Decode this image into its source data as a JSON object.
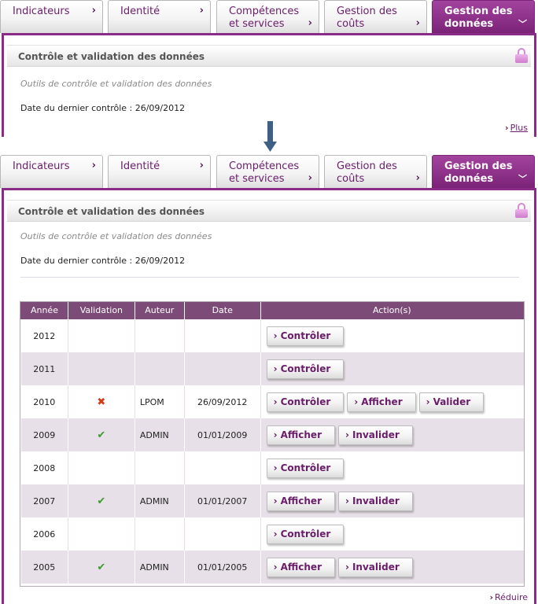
{
  "tabs": [
    {
      "label_line1": "Indicateurs",
      "label_line2": ""
    },
    {
      "label_line1": "Identité",
      "label_line2": ""
    },
    {
      "label_line1": "Compétences",
      "label_line2": "et services"
    },
    {
      "label_line1": "Gestion des",
      "label_line2": "coûts"
    },
    {
      "label_line1": "Gestion des",
      "label_line2": "données"
    }
  ],
  "panel": {
    "title": "Contrôle et validation des données",
    "subtitle": "Outils de contrôle et validation des données",
    "last_check": "Date du dernier contrôle : 26/09/2012",
    "more_link": "Plus",
    "less_link": "Réduire"
  },
  "table": {
    "headers": [
      "Année",
      "Validation",
      "Auteur",
      "Date",
      "Action(s)"
    ],
    "rows": [
      {
        "year": "2012",
        "validation": "",
        "author": "",
        "date": "",
        "actions": [
          "Contrôler"
        ]
      },
      {
        "year": "2011",
        "validation": "",
        "author": "",
        "date": "",
        "actions": [
          "Contrôler"
        ]
      },
      {
        "year": "2010",
        "validation": "✖",
        "author": "LPOM",
        "date": "26/09/2012",
        "actions": [
          "Contrôler",
          "Afficher",
          "Valider"
        ]
      },
      {
        "year": "2009",
        "validation": "✔",
        "author": "ADMIN",
        "date": "01/01/2009",
        "actions": [
          "Afficher",
          "Invalider"
        ]
      },
      {
        "year": "2008",
        "validation": "",
        "author": "",
        "date": "",
        "actions": [
          "Contrôler"
        ]
      },
      {
        "year": "2007",
        "validation": "✔",
        "author": "ADMIN",
        "date": "01/01/2007",
        "actions": [
          "Afficher",
          "Invalider"
        ]
      },
      {
        "year": "2006",
        "validation": "",
        "author": "",
        "date": "",
        "actions": [
          "Contrôler"
        ]
      },
      {
        "year": "2005",
        "validation": "✔",
        "author": "ADMIN",
        "date": "01/01/2005",
        "actions": [
          "Afficher",
          "Invalider"
        ]
      }
    ]
  },
  "icons": {
    "tab_chevron": "chevron-right-icon",
    "active_tab_chevron": "chevron-down-icon",
    "lock": "lock-icon",
    "transition_arrow": "arrow-down-icon",
    "invalid": "cross-icon",
    "valid": "check-icon"
  },
  "colors": {
    "brand": "#8a2b88",
    "table_header": "#7d4b78",
    "valid": "#3c9b2c",
    "invalid": "#d43a17"
  }
}
